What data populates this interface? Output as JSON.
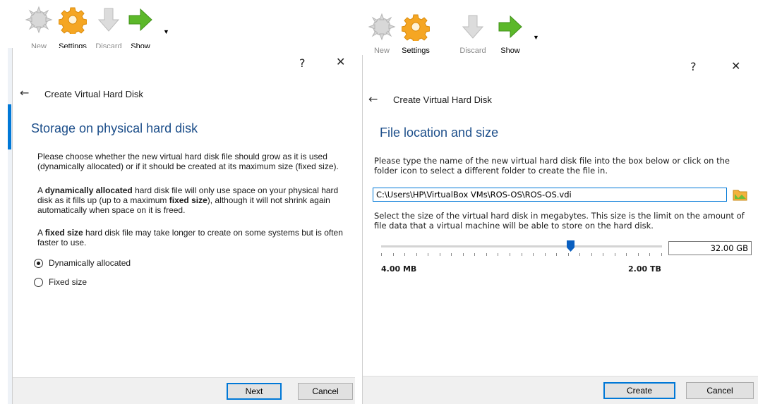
{
  "toolbar_left": {
    "new_label": "New",
    "settings_label": "Settings",
    "discard_label": "Discard",
    "show_label": "Show"
  },
  "toolbar_right": {
    "new_label": "New",
    "settings_label": "Settings",
    "discard_label": "Discard",
    "show_label": "Show"
  },
  "dialog_left": {
    "help": "?",
    "close": "✕",
    "back": "←",
    "title": "Create Virtual Hard Disk",
    "section_title": "Storage on physical hard disk",
    "para1": "Please choose whether the new virtual hard disk file should grow as it is used (dynamically allocated) or if it should be created at its maximum size (fixed size).",
    "para2_pre": "A ",
    "para2_bold1": "dynamically allocated",
    "para2_mid": " hard disk file will only use space on your physical hard disk as it fills up (up to a maximum ",
    "para2_bold2": "fixed size",
    "para2_post": "), although it will not shrink again automatically when space on it is freed.",
    "para3_pre": "A ",
    "para3_bold": "fixed size",
    "para3_post": " hard disk file may take longer to create on some systems but is often faster to use.",
    "option_dynamic": "Dynamically allocated",
    "option_fixed": "Fixed size",
    "next_label": "Next",
    "cancel_label": "Cancel"
  },
  "dialog_right": {
    "help": "?",
    "close": "✕",
    "back": "←",
    "title": "Create Virtual Hard Disk",
    "section_title": "File location and size",
    "para1": "Please type the name of the new virtual hard disk file into the box below or click on the folder icon to select a different folder to create the file in.",
    "file_path": "C:\\Users\\HP\\VirtualBox VMs\\ROS-OS\\ROS-OS.vdi",
    "para2": "Select the size of the virtual hard disk in megabytes. This size is the limit on the amount of file data that a virtual machine will be able to store on the hard disk.",
    "size_value": "32.00 GB",
    "slider_min": "4.00 MB",
    "slider_max": "2.00 TB",
    "create_label": "Create",
    "cancel_label": "Cancel"
  },
  "icons": {
    "new": "new-machine-icon",
    "settings": "gear-icon",
    "discard": "discard-arrow-icon",
    "show": "show-arrow-icon",
    "folder": "folder-icon"
  },
  "colors": {
    "accent": "#0078d7",
    "section_title": "#1c4e8a",
    "settings_gear": "#f5a623",
    "show_arrow": "#5cb82a"
  }
}
